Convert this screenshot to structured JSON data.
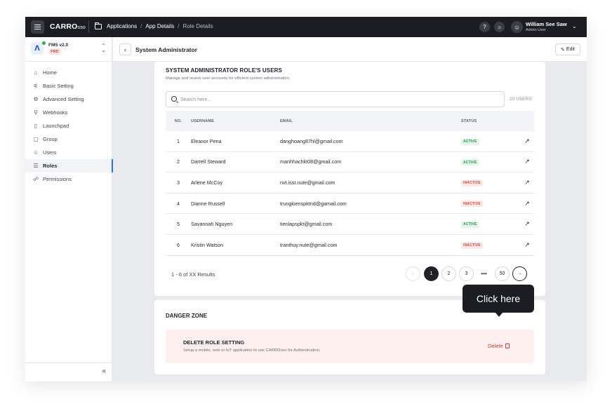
{
  "topbar": {
    "logo_main": "CARRO",
    "logo_suffix": "sso",
    "breadcrumb": [
      "Applications",
      "App Details",
      "Role Details"
    ],
    "breadcrumb_sep": "/",
    "help_icon": "?",
    "theme_icon": "☼",
    "user_name": "William See Saw",
    "user_role": "Admin User"
  },
  "sidebar": {
    "app_name": "FMS v2.0",
    "app_env": "PRD",
    "items": [
      {
        "label": "Home",
        "icon": "⌂"
      },
      {
        "label": "Basic Setting",
        "icon": "⚟"
      },
      {
        "label": "Advanced Setting",
        "icon": "⚙"
      },
      {
        "label": "Webhooks",
        "icon": "⚲"
      },
      {
        "label": "Launchpad",
        "icon": "▯"
      },
      {
        "label": "Group",
        "icon": "▢"
      },
      {
        "label": "Users",
        "icon": "☺"
      },
      {
        "label": "Roles",
        "icon": "☰"
      },
      {
        "label": "Permissions",
        "icon": "☍"
      }
    ],
    "active_index": 7,
    "collapse_icon": "«"
  },
  "header": {
    "title": "System Administrator",
    "edit_label": "Edit"
  },
  "users_section": {
    "title": "SYSTEM ADMINISTRATOR ROLE'S USERS",
    "subtitle": "Manage and review user accounts for efficient system administration.",
    "search_placeholder": "Search here...",
    "count_label": "20 USERS",
    "columns": [
      "NO.",
      "USERNAME",
      "EMAIL",
      "STATUS"
    ],
    "rows": [
      {
        "no": "1",
        "username": "Eleanor Pena",
        "email": "danghoang87hl@gmail.com",
        "status": "ACTIVE"
      },
      {
        "no": "2",
        "username": "Darrell Steward",
        "email": "manhhachkt08@gmail.com",
        "status": "ACTIVE"
      },
      {
        "no": "3",
        "username": "Arlene McCoy",
        "email": "nvt.isst.nute@gmail.com",
        "status": "INACTIVE"
      },
      {
        "no": "4",
        "username": "Dianne Russell",
        "email": "trungkienspktnd@gamail.com",
        "status": "INACTIVE"
      },
      {
        "no": "5",
        "username": "Savannah Nguyen",
        "email": "tienlapspkt@gmail.com",
        "status": "ACTIVE"
      },
      {
        "no": "6",
        "username": "Kristin Watson",
        "email": "tranthuy.nute@gmail.com",
        "status": "INACTIVE"
      }
    ],
    "results_label": "1 - 6 of XX Results",
    "pagination": {
      "prev": "←",
      "pages": [
        "1",
        "2",
        "3"
      ],
      "ellipsis": "•••",
      "last": "50",
      "next": "→",
      "current": "1"
    }
  },
  "danger_zone": {
    "title": "DANGER ZONE",
    "item_title": "DELETE ROLE SETTING",
    "item_desc": "Setup a mobile, web or IoT application to use CARROsso for Authentication.",
    "delete_label": "Delete"
  },
  "tooltip": {
    "text": "Click here"
  }
}
